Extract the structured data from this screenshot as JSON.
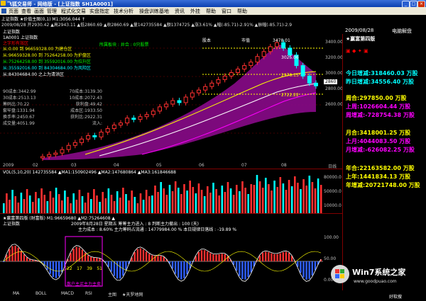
{
  "window": {
    "title": "飞狐交易师 - 网络版 - [上证指数 SH1A0001]",
    "min": "_",
    "max": "□",
    "close": "×"
  },
  "menu": [
    "页面",
    "查看",
    "画面",
    "管理",
    "程式化交易",
    "实盘指定",
    "技术分析",
    "操盘训练基地",
    "资讯",
    "外挂",
    "帮助",
    "窗口",
    "帮助"
  ],
  "status": {
    "line1": "上证指数 ★价值主图(0,1) M1:3056.044 ↑",
    "line2": "2009/08/28 开2930.42 ▲高2943.11 ▲低2860.69 ▲收2860.69 ▲量142735584 ▲额1374725 ▲涨3.61% ▲幅(-85.71)-2.91% ▲振幅(-85.71)-2.9"
  },
  "title_overlay": {
    "left": "上证指数",
    "mid": "所属板块 : 井合 : 0只股票",
    "r1": "股本",
    "r2": "市值"
  },
  "left_panel": {
    "r0": "1A0001  上证指数",
    "r1": "之字形有效区",
    "rows": [
      {
        "k": "从:0.00",
        "v": "到 96659328.00 为建仓区"
      },
      {
        "k": "从:96659328.00",
        "v": "到 75264258.00 为护盘区"
      },
      {
        "k": "从:75264258.00",
        "v": "到 35592016.00 为拉升区"
      },
      {
        "k": "从:35592016.00",
        "v": "到 84304684.00 为风险区"
      },
      {
        "k": "从:84304684.00",
        "v": "之上为清洪区"
      }
    ],
    "pairs": [
      [
        "90成本:3442.99",
        "70成本:3139.30"
      ],
      [
        "30成本:2513.13",
        "10成本:2072.43"
      ],
      [
        "筹码比:70.22",
        "获利盘:49.42"
      ],
      [
        "套牢盘:1331.94",
        "成本区:1933.50"
      ],
      [
        "换手率:2450.67",
        "获利比:2922.31"
      ],
      [
        "成交量:4051.99",
        "流入:"
      ]
    ]
  },
  "price_labels": {
    "high": "3478.01",
    "p1": "3025.06",
    "p2": "2978.15",
    "p3": "2722.22"
  },
  "yaxis": [
    "3400.00",
    "3200.00",
    "3000.00",
    "2800.00",
    "2600.00"
  ],
  "right_box": {
    "label": "2860"
  },
  "xaxis": [
    "2009",
    "02",
    "03",
    "04",
    "05",
    "06",
    "07",
    "08",
    "日线"
  ],
  "vol_header": "VOL(5,10,20) 142735584 ▲MA1:150902496 ▲MA2:147680864 ▲MA3:161846688",
  "vol_yaxis": [
    "80000.0",
    "50000.0",
    "10000.0"
  ],
  "ind_header1": "★赢富第四版 (财富版)   M1:96659680 ▲M2:75264608 ▲",
  "ind_header2": "2009年8月28日 星期五   筹筹主力进入 : 8   判断主力撤出 : 100 (天)",
  "ind_header3": "主力成本 : 8.60%   主力筹码占流通 : 14779984.00 %   本日规律日落线 : -19.89 %",
  "ind_left": "上证指数",
  "box_nums": [
    "22",
    "17",
    "39",
    "51"
  ],
  "box_caption": "散户主买主力主卖",
  "ind_yaxis": [
    "100.00",
    "50.00",
    "0.00"
  ],
  "right_panel": {
    "date": "2009/08/28",
    "tag": "电脑解盘",
    "edition": "★赢富第四版",
    "today": "今日增减:318460.03 万股",
    "yesterday": "昨日增减:34556.40 万股",
    "week": "周合:297850.00 万股",
    "last_week": "上周:1026604.44 万股",
    "week_delta": "周增减:-728754.38 万股",
    "month": "月合:3418001.25 万股",
    "last_month": "上月:4044083.50 万股",
    "month_delta": "月增减:-626082.25 万股",
    "year": "年合:22163582.00 万股",
    "last_year": "上年:1441834.13 万股",
    "year_delta": "年增减:20721748.00 万股"
  },
  "tabs": [
    "MA",
    "BOLL",
    "MACD",
    "RSI",
    "主图",
    "★天罗地网"
  ],
  "watermark": {
    "brand": "Win7系统之家",
    "site": "www.goodpuao.com",
    "site2": "好软搜"
  },
  "chart_data": {
    "type": "candlestick",
    "title": "上证指数",
    "ylim": [
      2600,
      3478.01
    ],
    "labels": {
      "high": 3478.01,
      "annotations": [
        3025.06,
        2978.15,
        2722.22
      ]
    },
    "closes": [
      1850,
      1880,
      1900,
      1950,
      2010,
      2050,
      2100,
      2150,
      2130,
      2200,
      2250,
      2300,
      2330,
      2400,
      2380,
      2420,
      2450,
      2500,
      2560,
      2600,
      2650,
      2620,
      2700,
      2760,
      2800,
      2850,
      2900,
      2950,
      3000,
      3050,
      3100,
      3150,
      3200,
      3280,
      3350,
      3420,
      3478,
      3400,
      3300,
      3150,
      3000,
      2900,
      2860
    ]
  }
}
